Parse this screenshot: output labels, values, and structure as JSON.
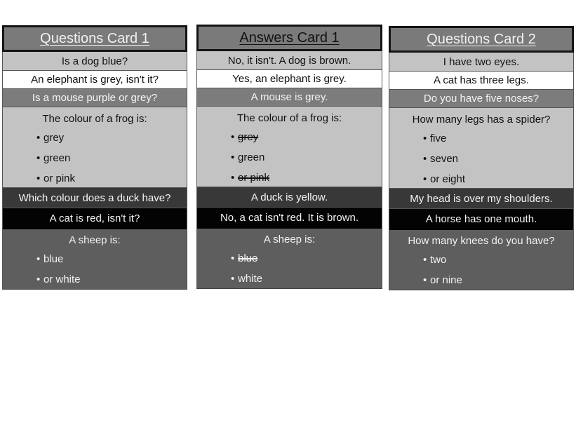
{
  "cards": [
    {
      "title": "Questions Card 1",
      "rows": [
        "Is a dog blue?",
        "An elephant is grey, isn't it?",
        "Is a mouse purple or grey?"
      ],
      "frog_block": {
        "heading": "The colour of a frog is:",
        "options": [
          {
            "text": "grey",
            "struck": false
          },
          {
            "text": "green",
            "struck": false
          },
          {
            "text": "or pink",
            "struck": false
          }
        ]
      },
      "dark_row": "Which colour does a duck have?",
      "black_row": "A cat is red, isn't it?",
      "sheep_block": {
        "heading": "A sheep is:",
        "options": [
          {
            "text": "blue",
            "struck": false
          },
          {
            "text": "or white",
            "struck": false
          }
        ]
      }
    },
    {
      "title": "Answers Card 1",
      "rows": [
        "No, it isn't. A dog is brown.",
        "Yes, an elephant is grey.",
        "A mouse is grey."
      ],
      "frog_block": {
        "heading": "The colour of a frog is:",
        "options": [
          {
            "text": "grey",
            "struck": true
          },
          {
            "text": "green",
            "struck": false
          },
          {
            "text": "or pink",
            "struck": true
          }
        ]
      },
      "dark_row": "A duck is yellow.",
      "black_row": "No, a cat isn't red. It is brown.",
      "sheep_block": {
        "heading": "A sheep is:",
        "options": [
          {
            "text": "blue",
            "struck": true
          },
          {
            "text": "white",
            "struck": false
          }
        ]
      }
    },
    {
      "title": "Questions Card 2",
      "rows": [
        "I have two eyes.",
        "A cat has three legs.",
        "Do you have five noses?"
      ],
      "frog_block": {
        "heading": "How many legs has a spider?",
        "options": [
          {
            "text": "five",
            "struck": false
          },
          {
            "text": "seven",
            "struck": false
          },
          {
            "text": "or eight",
            "struck": false
          }
        ]
      },
      "dark_row": "My head is over my shoulders.",
      "black_row": "A horse has one mouth.",
      "sheep_block": {
        "heading": "How many knees do you have?",
        "options": [
          {
            "text": "two",
            "struck": false
          },
          {
            "text": "or nine",
            "struck": false
          }
        ]
      }
    }
  ],
  "bullet": "•"
}
